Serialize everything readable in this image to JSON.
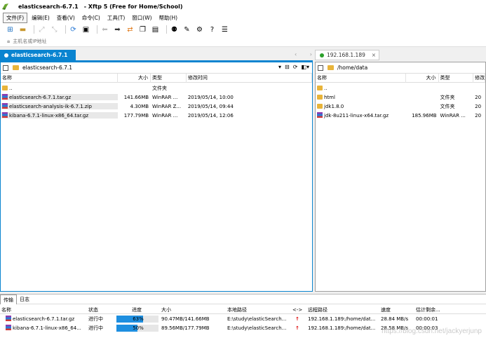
{
  "window": {
    "title": "elasticsearch-6.7.1",
    "subtitle": "- Xftp 5 (Free for Home/School)"
  },
  "menu": [
    "文件(F)",
    "编辑(E)",
    "查看(V)",
    "命令(C)",
    "工具(T)",
    "窗口(W)",
    "帮助(H)"
  ],
  "address": {
    "placeholder": "主机名或IP地址"
  },
  "tabs": {
    "left": "elasticsearch-6.7.1",
    "right": "192.168.1.189"
  },
  "left_pane": {
    "path": "elasticsearch-6.7.1",
    "columns": [
      "名称",
      "大小",
      "类型",
      "修改时间"
    ],
    "rows": [
      {
        "name": "..",
        "size": "",
        "type": "文件夹",
        "mtime": "",
        "icon": "folder"
      },
      {
        "name": "elasticsearch-6.7.1.tar.gz",
        "size": "141.66MB",
        "type": "WinRAR ...",
        "mtime": "2019/05/14, 10:00",
        "icon": "rar"
      },
      {
        "name": "elasticsearch-analysis-ik-6.7.1.zip",
        "size": "4.30MB",
        "type": "WinRAR Z...",
        "mtime": "2019/05/14, 09:44",
        "icon": "rar"
      },
      {
        "name": "kibana-6.7.1-linux-x86_64.tar.gz",
        "size": "177.79MB",
        "type": "WinRAR ...",
        "mtime": "2019/05/14, 12:06",
        "icon": "rar"
      }
    ]
  },
  "right_pane": {
    "path": "/home/data",
    "columns": [
      "名称",
      "大小",
      "类型",
      "修改"
    ],
    "rows": [
      {
        "name": "..",
        "size": "",
        "type": "",
        "mtime": "",
        "icon": "folder"
      },
      {
        "name": "html",
        "size": "",
        "type": "文件夹",
        "mtime": "20",
        "icon": "folder"
      },
      {
        "name": "jdk1.8.0",
        "size": "",
        "type": "文件夹",
        "mtime": "20",
        "icon": "folder"
      },
      {
        "name": "jdk-8u211-linux-x64.tar.gz",
        "size": "185.96MB",
        "type": "WinRAR ...",
        "mtime": "20",
        "icon": "rar"
      }
    ]
  },
  "transfer": {
    "tabs": [
      "传输",
      "日志"
    ],
    "columns": [
      "名称",
      "状态",
      "进度",
      "大小",
      "本地路径",
      "<->",
      "远程路径",
      "速度",
      "估计剩余..."
    ],
    "rows": [
      {
        "name": "elasticsearch-6.7.1.tar.gz",
        "status": "进行中",
        "progress": 63,
        "progress_label": "63%",
        "size": "90.47MB/141.66MB",
        "local": "E:\\study\\elasticSearch...",
        "remote": "192.168.1.189:/home/dat...",
        "speed": "28.84 MB/s",
        "eta": "00:00:01"
      },
      {
        "name": "kibana-6.7.1-linux-x86_64...",
        "status": "进行中",
        "progress": 50,
        "progress_label": "50%",
        "size": "89.56MB/177.79MB",
        "local": "E:\\study\\elasticSearch...",
        "remote": "192.168.1.189:/home/dat...",
        "speed": "28.58 MB/s",
        "eta": "00:00:03"
      }
    ]
  },
  "watermark": "https://blog.csdn.net/jackyerjunp",
  "colors": {
    "accent": "#0a84d0",
    "progress": "#1e8fe0"
  }
}
